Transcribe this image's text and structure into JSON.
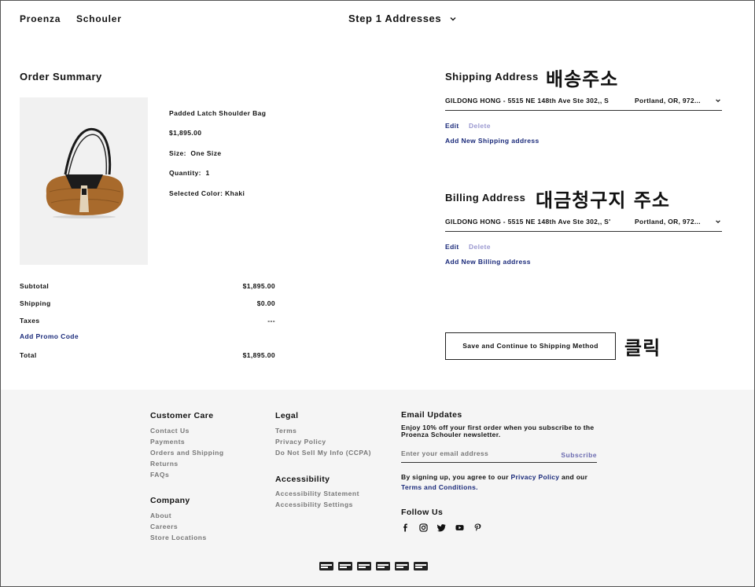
{
  "header": {
    "brand_first": "Proenza",
    "brand_second": "Schouler",
    "step_label": "Step 1 Addresses"
  },
  "order_summary": {
    "title": "Order Summary",
    "product": {
      "name": "Padded Latch Shoulder Bag",
      "price": "$1,895.00",
      "size_label": "Size:",
      "size_value": "One Size",
      "quantity_label": "Quantity:",
      "quantity_value": "1",
      "color_label": "Selected Color:",
      "color_value": "Khaki"
    },
    "totals": [
      {
        "label": "Subtotal",
        "value": "$1,895.00"
      },
      {
        "label": "Shipping",
        "value": "$0.00"
      },
      {
        "label": "Taxes",
        "value": "---"
      },
      {
        "label": "Total",
        "value": "$1,895.00"
      }
    ],
    "promo_link": "Add Promo Code"
  },
  "shipping": {
    "title": "Shipping Address",
    "annotation": "배송주소",
    "address_line": "GILDONG HONG - 5515 NE 148th Ave Ste 302,, S",
    "address_city": "Portland, OR, 972...",
    "edit": "Edit",
    "delete": "Delete",
    "add_new": "Add New Shipping address"
  },
  "billing": {
    "title": "Billing Address",
    "annotation": "대금청구지 주소",
    "address_line": "GILDONG HONG - 5515 NE 148th Ave Ste 302,, S'",
    "address_city": "Portland, OR, 972...",
    "edit": "Edit",
    "delete": "Delete",
    "add_new": "Add New Billing address"
  },
  "continue_button": {
    "label": "Save and Continue to Shipping Method",
    "annotation": "클릭"
  },
  "footer": {
    "customer_care": {
      "title": "Customer Care",
      "links": [
        "Contact Us",
        "Payments",
        "Orders and Shipping",
        "Returns",
        "FAQs"
      ]
    },
    "company": {
      "title": "Company",
      "links": [
        "About",
        "Careers",
        "Store Locations"
      ]
    },
    "legal": {
      "title": "Legal",
      "links": [
        "Terms",
        "Privacy Policy",
        "Do Not Sell My Info (CCPA)"
      ]
    },
    "accessibility": {
      "title": "Accessibility",
      "links": [
        "Accessibility Statement",
        "Accessibility Settings"
      ]
    },
    "email": {
      "title": "Email Updates",
      "line1": "Enjoy 10% off your first order when you subscribe to the",
      "line2": "Proenza Schouler newsletter.",
      "placeholder": "Enter your email address",
      "subscribe": "Subscribe",
      "legal_pre": "By signing up, you agree to our",
      "privacy_link": "Privacy Policy",
      "legal_mid": "and our",
      "terms_link": "Terms and Conditions."
    },
    "follow": {
      "title": "Follow Us",
      "icons": [
        "facebook-icon",
        "instagram-icon",
        "twitter-icon",
        "youtube-icon",
        "pinterest-icon"
      ]
    },
    "payment_icons": [
      "amex-icon",
      "discover-icon",
      "mastercard-icon",
      "paypal-icon",
      "visa-icon",
      "klarna-icon"
    ]
  },
  "colors": {
    "link_blue": "#1a2a7a",
    "delete_lavender": "#9a98d0",
    "footer_bg": "#f5f5f5",
    "muted_text": "#777777"
  }
}
